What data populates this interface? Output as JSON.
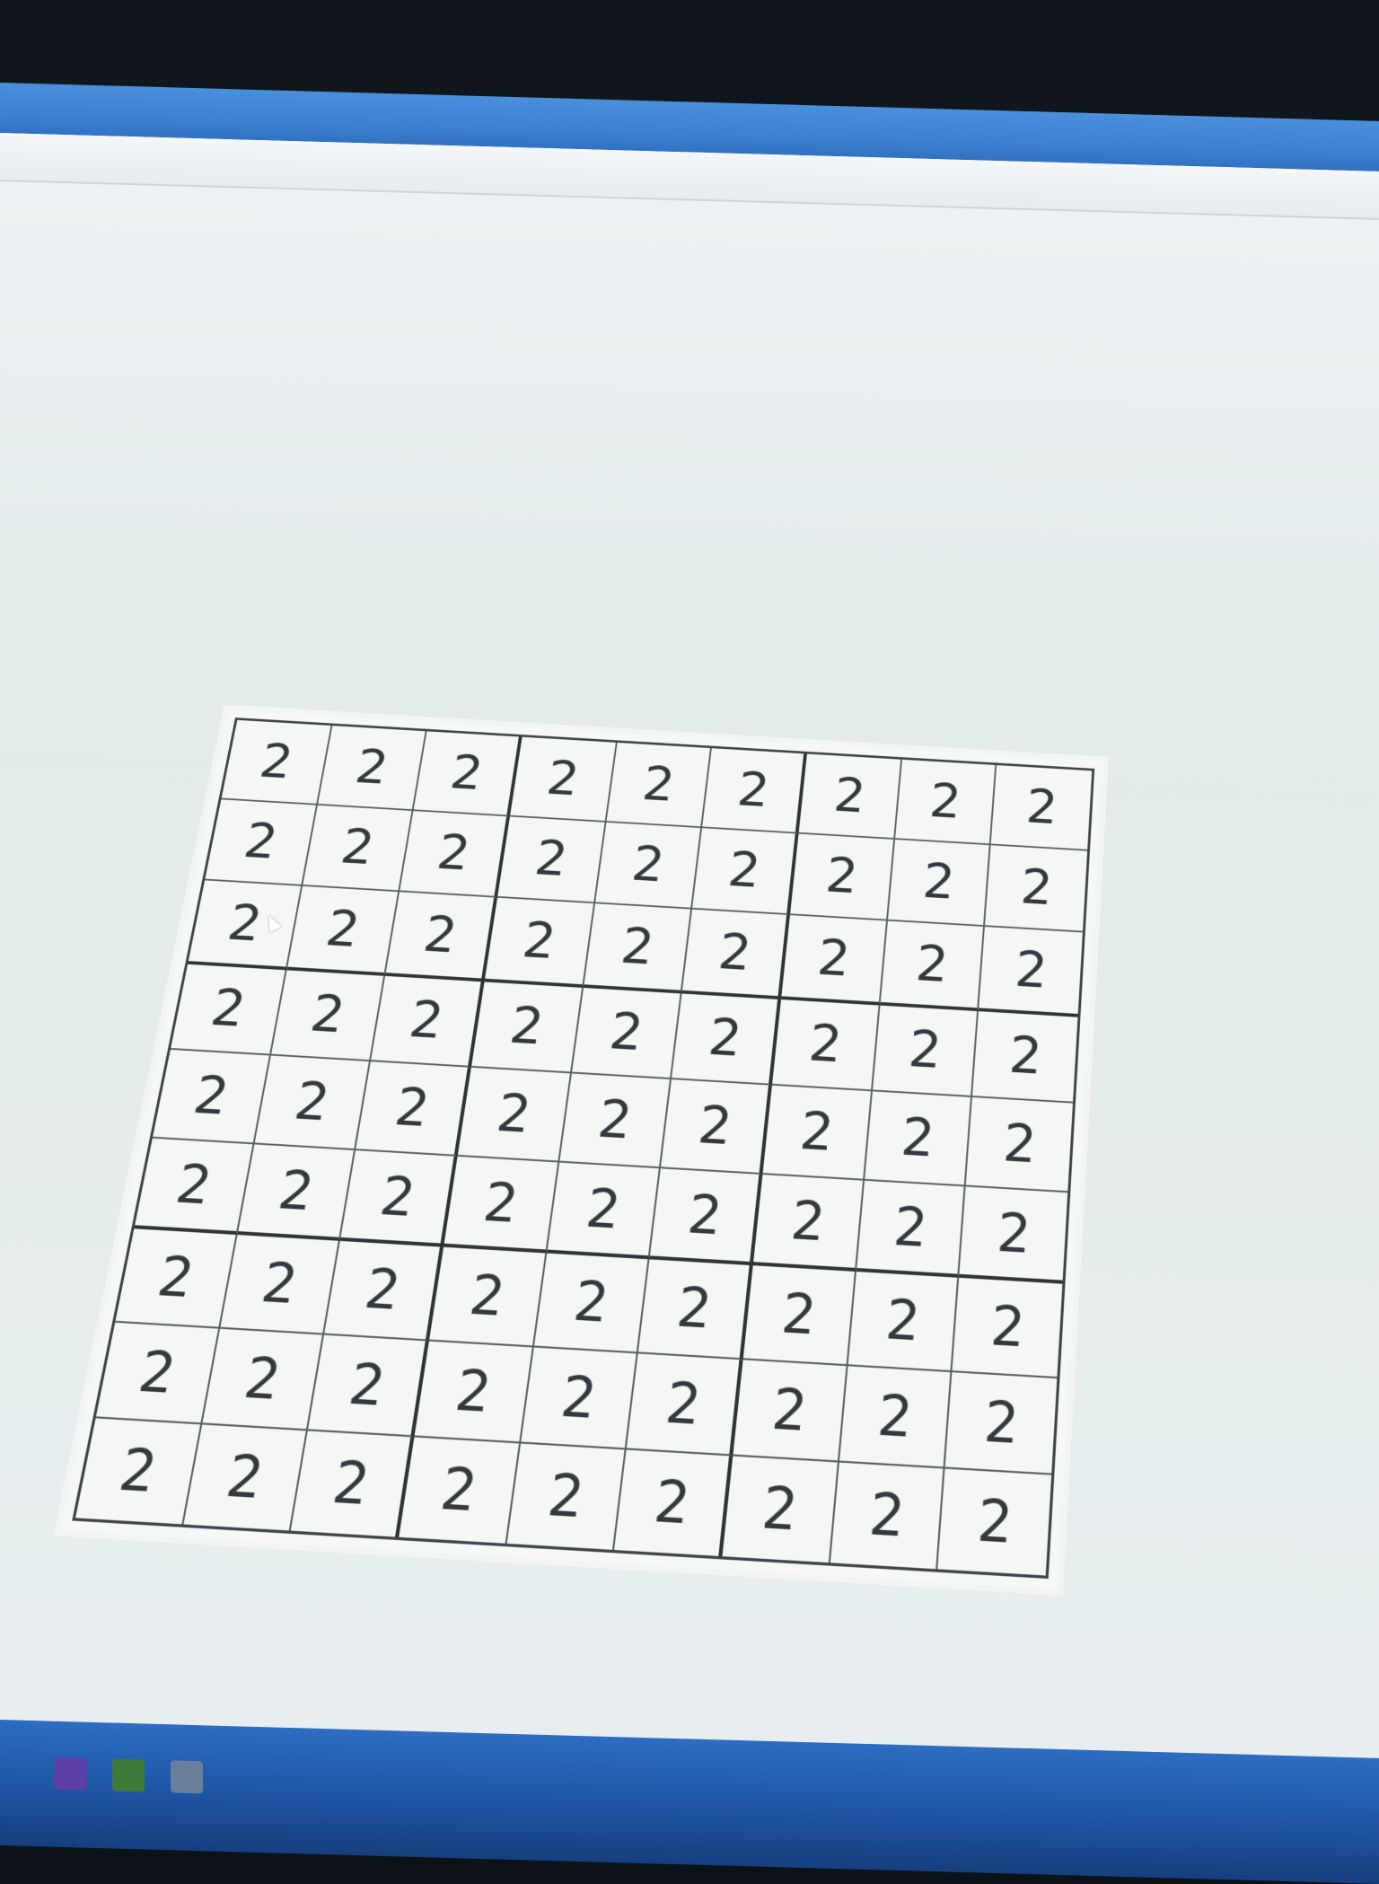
{
  "sudoku": {
    "rows": [
      [
        "2",
        "2",
        "2",
        "2",
        "2",
        "2",
        "2",
        "2",
        "2"
      ],
      [
        "2",
        "2",
        "2",
        "2",
        "2",
        "2",
        "2",
        "2",
        "2"
      ],
      [
        "2",
        "2",
        "2",
        "2",
        "2",
        "2",
        "2",
        "2",
        "2"
      ],
      [
        "2",
        "2",
        "2",
        "2",
        "2",
        "2",
        "2",
        "2",
        "2"
      ],
      [
        "2",
        "2",
        "2",
        "2",
        "2",
        "2",
        "2",
        "2",
        "2"
      ],
      [
        "2",
        "2",
        "2",
        "2",
        "2",
        "2",
        "2",
        "2",
        "2"
      ],
      [
        "2",
        "2",
        "2",
        "2",
        "2",
        "2",
        "2",
        "2",
        "2"
      ],
      [
        "2",
        "2",
        "2",
        "2",
        "2",
        "2",
        "2",
        "2",
        "2"
      ],
      [
        "2",
        "2",
        "2",
        "2",
        "2",
        "2",
        "2",
        "2",
        "2"
      ]
    ]
  },
  "colors": {
    "title_bar": "#3b7fd0",
    "window_bg": "#e4ecea",
    "grid_line": "#3e4448",
    "digit": "#34393d",
    "taskbar": "#1f56a6"
  },
  "icons": {
    "cursor": "mouse-pointer-icon"
  }
}
